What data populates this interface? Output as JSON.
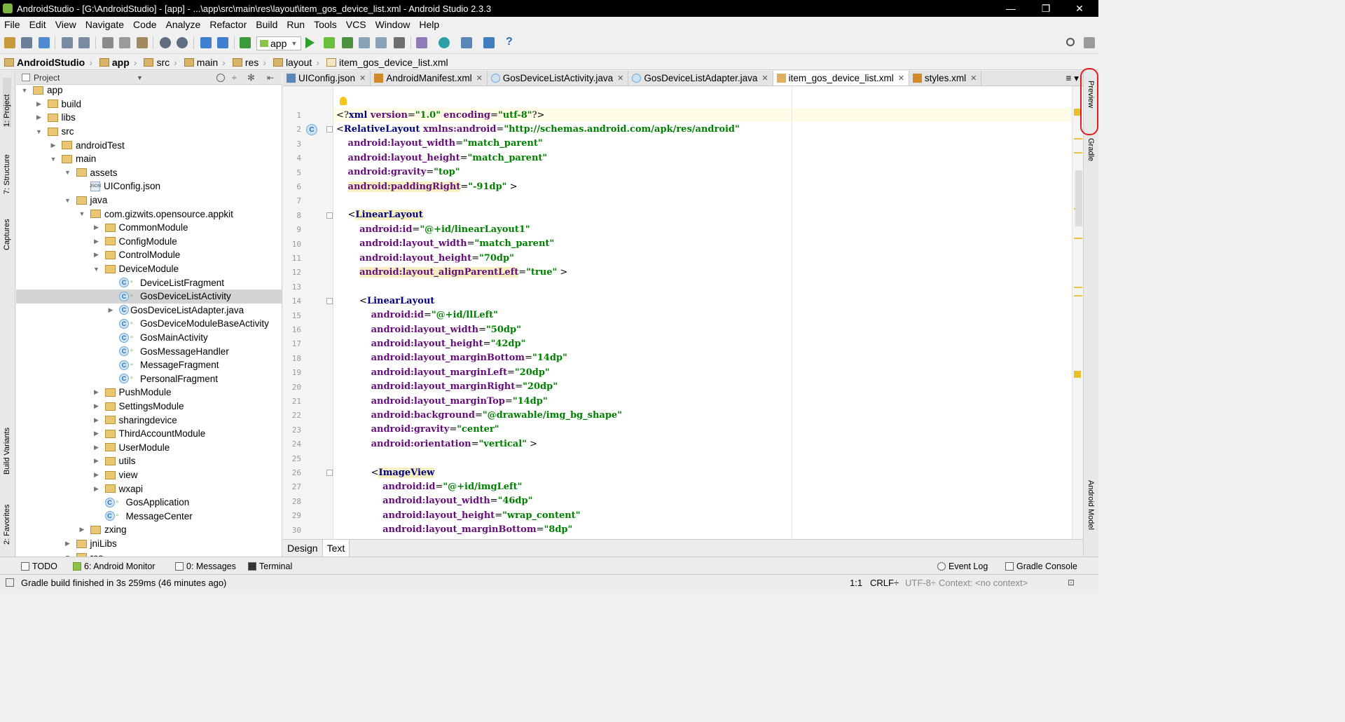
{
  "window": {
    "title": "AndroidStudio - [G:\\AndroidStudio] - [app] - ...\\app\\src\\main\\res\\layout\\item_gos_device_list.xml - Android Studio 2.3.3",
    "minimize": "—",
    "maximize": "❐",
    "close": "✕"
  },
  "menu": [
    "File",
    "Edit",
    "View",
    "Navigate",
    "Code",
    "Analyze",
    "Refactor",
    "Build",
    "Run",
    "Tools",
    "VCS",
    "Window",
    "Help"
  ],
  "toolbar": {
    "run_config": "app"
  },
  "breadcrumb": [
    "AndroidStudio",
    "app",
    "src",
    "main",
    "res",
    "layout",
    "item_gos_device_list.xml"
  ],
  "left_strip": {
    "project": "1: Project",
    "structure": "7: Structure",
    "captures": "Captures",
    "build_variants": "Build Variants",
    "favorites": "2: Favorites"
  },
  "right_strip": {
    "preview": "Preview",
    "gradle": "Gradle",
    "android_model": "Android Model"
  },
  "project_panel": {
    "title": "Project"
  },
  "tree": [
    {
      "label": "app",
      "indent": 1,
      "type": "folder",
      "expanded": true
    },
    {
      "label": "build",
      "indent": 2,
      "type": "folder",
      "expanded": false
    },
    {
      "label": "libs",
      "indent": 2,
      "type": "folder",
      "expanded": false
    },
    {
      "label": "src",
      "indent": 2,
      "type": "folder",
      "expanded": true
    },
    {
      "label": "androidTest",
      "indent": 3,
      "type": "folder",
      "expanded": false
    },
    {
      "label": "main",
      "indent": 3,
      "type": "folder",
      "expanded": true
    },
    {
      "label": "assets",
      "indent": 4,
      "type": "folder",
      "expanded": true
    },
    {
      "label": "UIConfig.json",
      "indent": 5,
      "type": "json"
    },
    {
      "label": "java",
      "indent": 4,
      "type": "folder",
      "expanded": true
    },
    {
      "label": "com.gizwits.opensource.appkit",
      "indent": 5,
      "type": "folder",
      "expanded": true
    },
    {
      "label": "CommonModule",
      "indent": 6,
      "type": "folder",
      "expanded": false
    },
    {
      "label": "ConfigModule",
      "indent": 6,
      "type": "folder",
      "expanded": false
    },
    {
      "label": "ControlModule",
      "indent": 6,
      "type": "folder",
      "expanded": false
    },
    {
      "label": "DeviceModule",
      "indent": 6,
      "type": "folder",
      "expanded": true
    },
    {
      "label": "DeviceListFragment",
      "indent": 7,
      "type": "class"
    },
    {
      "label": "GosDeviceListActivity",
      "indent": 7,
      "type": "class",
      "selected": true
    },
    {
      "label": "GosDeviceListAdapter.java",
      "indent": 7,
      "type": "classfile",
      "expanded": false
    },
    {
      "label": "GosDeviceModuleBaseActivity",
      "indent": 7,
      "type": "class"
    },
    {
      "label": "GosMainActivity",
      "indent": 7,
      "type": "class"
    },
    {
      "label": "GosMessageHandler",
      "indent": 7,
      "type": "class"
    },
    {
      "label": "MessageFragment",
      "indent": 7,
      "type": "class"
    },
    {
      "label": "PersonalFragment",
      "indent": 7,
      "type": "class"
    },
    {
      "label": "PushModule",
      "indent": 6,
      "type": "folder",
      "expanded": false
    },
    {
      "label": "SettingsModule",
      "indent": 6,
      "type": "folder",
      "expanded": false
    },
    {
      "label": "sharingdevice",
      "indent": 6,
      "type": "folder",
      "expanded": false
    },
    {
      "label": "ThirdAccountModule",
      "indent": 6,
      "type": "folder",
      "expanded": false
    },
    {
      "label": "UserModule",
      "indent": 6,
      "type": "folder",
      "expanded": false
    },
    {
      "label": "utils",
      "indent": 6,
      "type": "folder",
      "expanded": false
    },
    {
      "label": "view",
      "indent": 6,
      "type": "folder",
      "expanded": false
    },
    {
      "label": "wxapi",
      "indent": 6,
      "type": "folder",
      "expanded": false
    },
    {
      "label": "GosApplication",
      "indent": 6,
      "type": "class"
    },
    {
      "label": "MessageCenter",
      "indent": 6,
      "type": "class"
    },
    {
      "label": "zxing",
      "indent": 5,
      "type": "folder",
      "expanded": false
    },
    {
      "label": "jniLibs",
      "indent": 4,
      "type": "folder",
      "expanded": false
    },
    {
      "label": "res",
      "indent": 4,
      "type": "folder",
      "expanded": true
    }
  ],
  "tabs": [
    {
      "label": "UIConfig.json",
      "icon": "json-file-icon",
      "active": false
    },
    {
      "label": "AndroidManifest.xml",
      "icon": "xml-file-icon",
      "active": false
    },
    {
      "label": "GosDeviceListActivity.java",
      "icon": "class-icon",
      "active": false
    },
    {
      "label": "GosDeviceListAdapter.java",
      "icon": "class-icon",
      "active": false
    },
    {
      "label": "item_gos_device_list.xml",
      "icon": "layout-file-icon",
      "active": true
    },
    {
      "label": "styles.xml",
      "icon": "xml-file-icon",
      "active": false
    }
  ],
  "code": [
    [
      {
        "t": "<?",
        "c": "br"
      },
      {
        "t": "xml ",
        "c": "pi"
      },
      {
        "t": "version",
        "c": "attr"
      },
      {
        "t": "=",
        "c": "br"
      },
      {
        "t": "\"1.0\"",
        "c": "str"
      },
      {
        "t": " ",
        "c": "br"
      },
      {
        "t": "encoding",
        "c": "attr"
      },
      {
        "t": "=",
        "c": "br"
      },
      {
        "t": "\"utf-8\"",
        "c": "str"
      },
      {
        "t": "?>",
        "c": "br"
      }
    ],
    [
      {
        "t": "<",
        "c": "br"
      },
      {
        "t": "RelativeLayout ",
        "c": "tag"
      },
      {
        "t": "xmlns:android",
        "c": "attr"
      },
      {
        "t": "=",
        "c": "br"
      },
      {
        "t": "\"http://schemas.android.com/apk/res/android\"",
        "c": "str"
      }
    ],
    [
      {
        "t": "    ",
        "c": "br"
      },
      {
        "t": "android:layout_width",
        "c": "attr"
      },
      {
        "t": "=",
        "c": "br"
      },
      {
        "t": "\"match_parent\"",
        "c": "str"
      }
    ],
    [
      {
        "t": "    ",
        "c": "br"
      },
      {
        "t": "android:layout_height",
        "c": "attr"
      },
      {
        "t": "=",
        "c": "br"
      },
      {
        "t": "\"match_parent\"",
        "c": "str"
      }
    ],
    [
      {
        "t": "    ",
        "c": "br"
      },
      {
        "t": "android:gravity",
        "c": "attr"
      },
      {
        "t": "=",
        "c": "br"
      },
      {
        "t": "\"top\"",
        "c": "str"
      }
    ],
    [
      {
        "t": "    ",
        "c": "br"
      },
      {
        "t": "android:paddingRight",
        "c": "attr",
        "hl": true
      },
      {
        "t": "=",
        "c": "br"
      },
      {
        "t": "\"-91dp\"",
        "c": "str"
      },
      {
        "t": " >",
        "c": "br"
      }
    ],
    [],
    [
      {
        "t": "    <",
        "c": "br"
      },
      {
        "t": "LinearLayout",
        "c": "tag",
        "hl": true
      }
    ],
    [
      {
        "t": "        ",
        "c": "br"
      },
      {
        "t": "android:id",
        "c": "attr"
      },
      {
        "t": "=",
        "c": "br"
      },
      {
        "t": "\"@+id/linearLayout1\"",
        "c": "str"
      }
    ],
    [
      {
        "t": "        ",
        "c": "br"
      },
      {
        "t": "android:layout_width",
        "c": "attr"
      },
      {
        "t": "=",
        "c": "br"
      },
      {
        "t": "\"match_parent\"",
        "c": "str"
      }
    ],
    [
      {
        "t": "        ",
        "c": "br"
      },
      {
        "t": "android:layout_height",
        "c": "attr"
      },
      {
        "t": "=",
        "c": "br"
      },
      {
        "t": "\"70dp\"",
        "c": "str"
      }
    ],
    [
      {
        "t": "        ",
        "c": "br"
      },
      {
        "t": "android:layout_alignParentLeft",
        "c": "attr",
        "hl": true
      },
      {
        "t": "=",
        "c": "br"
      },
      {
        "t": "\"true\"",
        "c": "str"
      },
      {
        "t": " >",
        "c": "br"
      }
    ],
    [],
    [
      {
        "t": "        <",
        "c": "br"
      },
      {
        "t": "LinearLayout",
        "c": "tag"
      }
    ],
    [
      {
        "t": "            ",
        "c": "br"
      },
      {
        "t": "android:id",
        "c": "attr"
      },
      {
        "t": "=",
        "c": "br"
      },
      {
        "t": "\"@+id/llLeft\"",
        "c": "str"
      }
    ],
    [
      {
        "t": "            ",
        "c": "br"
      },
      {
        "t": "android:layout_width",
        "c": "attr"
      },
      {
        "t": "=",
        "c": "br"
      },
      {
        "t": "\"50dp\"",
        "c": "str"
      }
    ],
    [
      {
        "t": "            ",
        "c": "br"
      },
      {
        "t": "android:layout_height",
        "c": "attr"
      },
      {
        "t": "=",
        "c": "br"
      },
      {
        "t": "\"42dp\"",
        "c": "str"
      }
    ],
    [
      {
        "t": "            ",
        "c": "br"
      },
      {
        "t": "android:layout_marginBottom",
        "c": "attr"
      },
      {
        "t": "=",
        "c": "br"
      },
      {
        "t": "\"14dp\"",
        "c": "str"
      }
    ],
    [
      {
        "t": "            ",
        "c": "br"
      },
      {
        "t": "android:layout_marginLeft",
        "c": "attr"
      },
      {
        "t": "=",
        "c": "br"
      },
      {
        "t": "\"20dp\"",
        "c": "str"
      }
    ],
    [
      {
        "t": "            ",
        "c": "br"
      },
      {
        "t": "android:layout_marginRight",
        "c": "attr"
      },
      {
        "t": "=",
        "c": "br"
      },
      {
        "t": "\"20dp\"",
        "c": "str"
      }
    ],
    [
      {
        "t": "            ",
        "c": "br"
      },
      {
        "t": "android:layout_marginTop",
        "c": "attr"
      },
      {
        "t": "=",
        "c": "br"
      },
      {
        "t": "\"14dp\"",
        "c": "str"
      }
    ],
    [
      {
        "t": "            ",
        "c": "br"
      },
      {
        "t": "android:background",
        "c": "attr"
      },
      {
        "t": "=",
        "c": "br"
      },
      {
        "t": "\"@drawable/img_bg_shape\"",
        "c": "str"
      }
    ],
    [
      {
        "t": "            ",
        "c": "br"
      },
      {
        "t": "android:gravity",
        "c": "attr"
      },
      {
        "t": "=",
        "c": "br"
      },
      {
        "t": "\"center\"",
        "c": "str"
      }
    ],
    [
      {
        "t": "            ",
        "c": "br"
      },
      {
        "t": "android:orientation",
        "c": "attr"
      },
      {
        "t": "=",
        "c": "br"
      },
      {
        "t": "\"vertical\"",
        "c": "str"
      },
      {
        "t": " >",
        "c": "br"
      }
    ],
    [],
    [
      {
        "t": "            <",
        "c": "br"
      },
      {
        "t": "ImageView",
        "c": "tag",
        "hl": true
      }
    ],
    [
      {
        "t": "                ",
        "c": "br"
      },
      {
        "t": "android:id",
        "c": "attr"
      },
      {
        "t": "=",
        "c": "br"
      },
      {
        "t": "\"@+id/imgLeft\"",
        "c": "str"
      }
    ],
    [
      {
        "t": "                ",
        "c": "br"
      },
      {
        "t": "android:layout_width",
        "c": "attr"
      },
      {
        "t": "=",
        "c": "br"
      },
      {
        "t": "\"46dp\"",
        "c": "str"
      }
    ],
    [
      {
        "t": "                ",
        "c": "br"
      },
      {
        "t": "android:layout_height",
        "c": "attr"
      },
      {
        "t": "=",
        "c": "br"
      },
      {
        "t": "\"wrap_content\"",
        "c": "str"
      }
    ],
    [
      {
        "t": "                ",
        "c": "br"
      },
      {
        "t": "android:layout_marginBottom",
        "c": "attr"
      },
      {
        "t": "=",
        "c": "br"
      },
      {
        "t": "\"8dp\"",
        "c": "str"
      }
    ]
  ],
  "design_tabs": [
    {
      "label": "Design",
      "active": false
    },
    {
      "label": "Text",
      "active": true
    }
  ],
  "bottom_tools": {
    "todo": "TODO",
    "android_monitor": "6: Android Monitor",
    "messages": "0: Messages",
    "terminal": "Terminal",
    "event_log": "Event Log",
    "gradle_console": "Gradle Console"
  },
  "status": {
    "message": "Gradle build finished in 3s 259ms (46 minutes ago)",
    "position": "1:1",
    "line_sep": "CRLF÷",
    "encoding": "UTF-8÷",
    "context": "Context: <no context>"
  },
  "colors": {
    "accent": "#3875d7",
    "annotation": "#e02020"
  }
}
